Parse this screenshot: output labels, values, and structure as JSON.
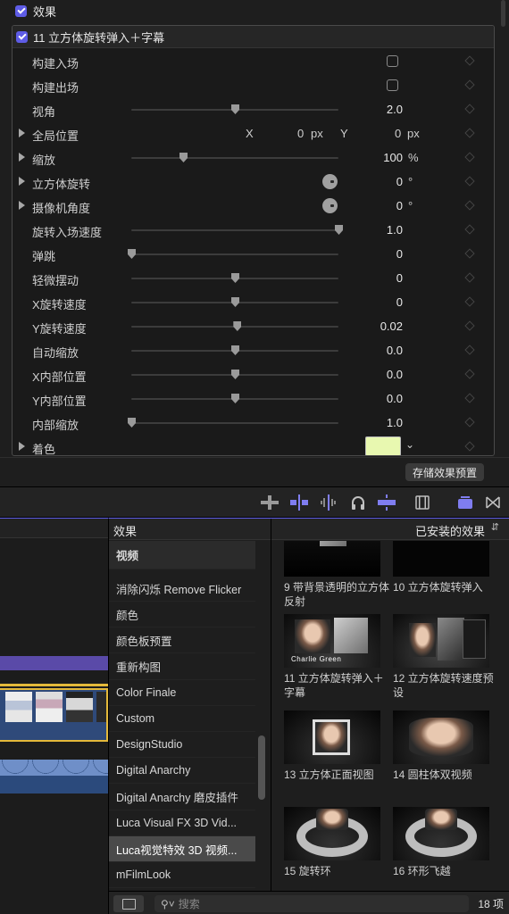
{
  "inspector": {
    "section_label": "效果",
    "effect_label": "11 立方体旋转弹入＋字幕",
    "params": [
      {
        "name": "构建入场",
        "kind": "checkbox"
      },
      {
        "name": "构建出场",
        "kind": "checkbox"
      },
      {
        "name": "视角",
        "kind": "slider",
        "level": 0.5,
        "value": "2.0"
      },
      {
        "name": "全局位置",
        "kind": "xy",
        "x_label": "X",
        "x_value": "0",
        "x_unit": "px",
        "y_label": "Y",
        "y_value": "0",
        "y_unit": "px"
      },
      {
        "name": "缩放",
        "kind": "slider",
        "level": 0.25,
        "value": "100",
        "unit": "%"
      },
      {
        "name": "立方体旋转",
        "kind": "dial",
        "value": "0",
        "unit": "°"
      },
      {
        "name": "摄像机角度",
        "kind": "dial",
        "value": "0",
        "unit": "°"
      },
      {
        "name": "旋转入场速度",
        "kind": "slider",
        "level": 1.0,
        "value": "1.0"
      },
      {
        "name": "弹跳",
        "kind": "slider",
        "level": 0.0,
        "value": "0"
      },
      {
        "name": "轻微摆动",
        "kind": "slider",
        "level": 0.5,
        "value": "0"
      },
      {
        "name": "X旋转速度",
        "kind": "slider",
        "level": 0.5,
        "value": "0"
      },
      {
        "name": "Y旋转速度",
        "kind": "slider",
        "level": 0.51,
        "value": "0.02"
      },
      {
        "name": "自动缩放",
        "kind": "slider",
        "level": 0.5,
        "value": "0.0"
      },
      {
        "name": "X内部位置",
        "kind": "slider",
        "level": 0.5,
        "value": "0.0"
      },
      {
        "name": "Y内部位置",
        "kind": "slider",
        "level": 0.5,
        "value": "0.0"
      },
      {
        "name": "内部缩放",
        "kind": "slider",
        "level": 0.0,
        "value": "1.0"
      },
      {
        "name": "着色",
        "kind": "color",
        "color": "#e8f8b0"
      }
    ],
    "save_preset_label": "存储效果预置"
  },
  "colors": {
    "accent": "#5e5ce6",
    "clip_border": "#e4b93a"
  },
  "browser": {
    "header_left": "效果",
    "header_right": "已安装的效果",
    "categories": [
      "视频",
      "消除闪烁 Remove Flicker",
      "颜色",
      "颜色板预置",
      "重新构图",
      "Color Finale",
      "Custom",
      "DesignStudio",
      "Digital Anarchy",
      "Digital Anarchy 磨皮插件",
      "Luca Visual FX 3D Vid...",
      "Luca视觉特效 3D 视频...",
      "mFilmLook"
    ],
    "selected_category": "Luca视觉特效 3D 视频...",
    "effects": [
      {
        "caption": "9 带背景透明的立方体反射",
        "thumb_text": ""
      },
      {
        "caption": "10 立方体旋转弹入",
        "thumb_text": ""
      },
      {
        "caption": "11 立方体旋转弹入＋字幕",
        "thumb_text": "Charlie Green"
      },
      {
        "caption": "12 立方体旋转速度预设",
        "thumb_text": ""
      },
      {
        "caption": "13 立方体正面视图",
        "thumb_text": ""
      },
      {
        "caption": "14 圆柱体双视频",
        "thumb_text": ""
      },
      {
        "caption": "15 旋转环",
        "thumb_text": ""
      },
      {
        "caption": "16 环形飞越",
        "thumb_text": ""
      }
    ],
    "search_placeholder": "搜索",
    "item_count": "18 项"
  }
}
